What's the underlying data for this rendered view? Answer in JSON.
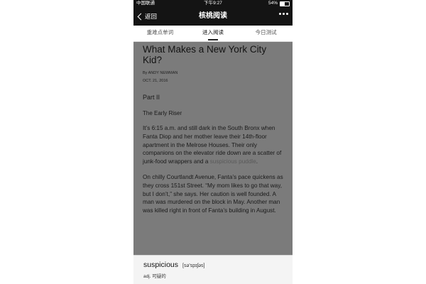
{
  "status_bar": {
    "carrier": "中国联通",
    "time": "下午9:27",
    "battery": "54%",
    "battery_level": 0.54
  },
  "nav": {
    "back_label": "返回",
    "title": "核桃阅读"
  },
  "tabs": [
    {
      "label": "重难点单词"
    },
    {
      "label": "进入阅读",
      "active": true
    },
    {
      "label": "今日测试"
    }
  ],
  "article": {
    "title": "What Makes a New York City Kid?",
    "byline": "By ANDY NEWMAN",
    "date": "OCT. 21, 2016",
    "part": "Part II",
    "subtitle": "The Early Riser",
    "p1_before": "It’s 6:15 a.m. and still dark in the South Bronx when Fanta Diop and her mother leave their 14th-floor apartment in the Melrose Houses. Their only companions on the elevator ride down are a scatter of junk-food wrappers and a ",
    "p1_highlight": "suspicious puddle",
    "p1_after": ".",
    "p2": "On chilly Courtlandt Avenue, Fanta’s pace quickens as they cross 151st Street. “My mom likes to go that way, but I don’t,” she says. Her caution is well founded. A man was murdered on the block in May. Another man was killed right in front of Fanta’s building in August."
  },
  "dictionary": {
    "word": "suspicious",
    "phonetic": "[sə'spɪʃəs]",
    "definition": "adj. 可疑的"
  }
}
